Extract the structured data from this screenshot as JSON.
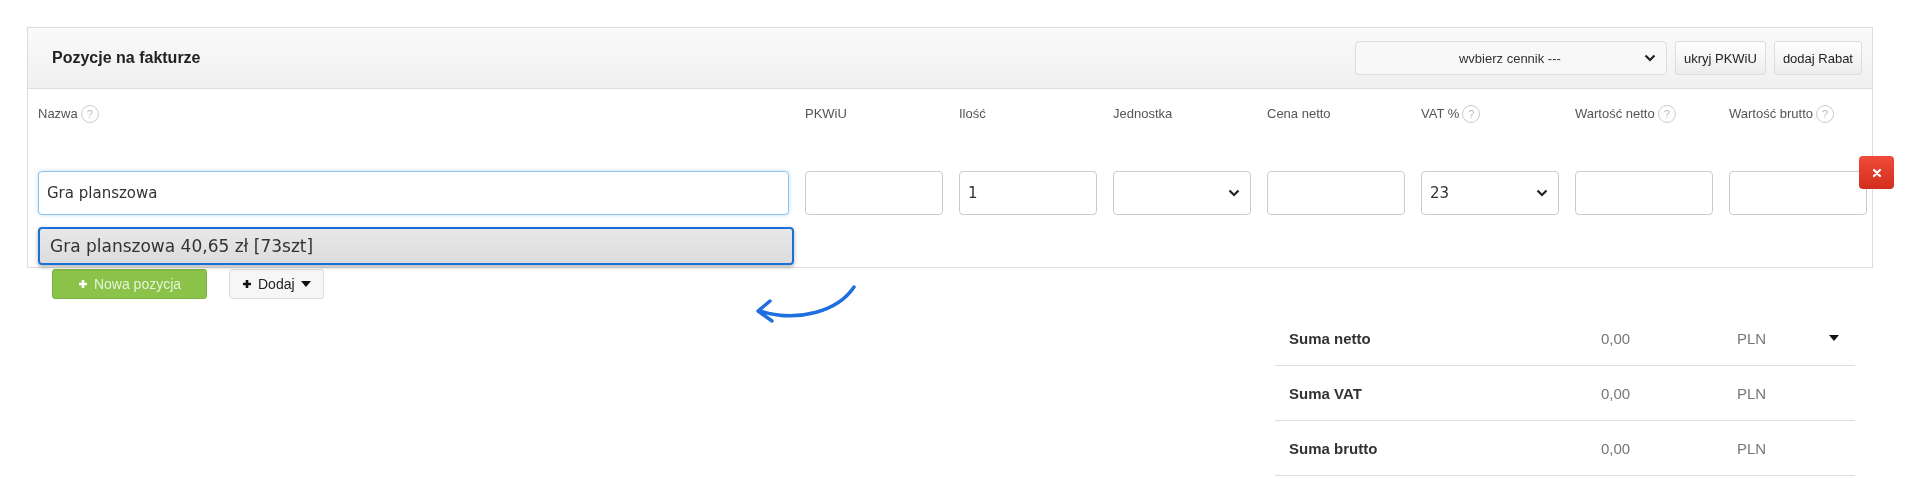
{
  "panel": {
    "title": "Pozycje na fakturze",
    "pricelist_select": {
      "value": "wvbierz cennik ---"
    },
    "header_buttons": [
      "ukryj PKWiU",
      "dodaj Rabat"
    ],
    "columns": [
      {
        "label": "Nazwa",
        "help": "?"
      },
      {
        "label": "PKWiU"
      },
      {
        "label": "Ilość"
      },
      {
        "label": "Jednostka"
      },
      {
        "label": "Cena netto"
      },
      {
        "label": "VAT %",
        "help": "?"
      },
      {
        "label": "Wartość netto",
        "help": "?"
      },
      {
        "label": "Wartość brutto",
        "help": "?"
      }
    ],
    "row": {
      "cells": [
        {
          "kind": "text",
          "value": "Gra planszowa",
          "focused": true
        },
        {
          "kind": "text",
          "focused": false
        },
        {
          "kind": "text",
          "value": "1",
          "focused": false
        },
        {
          "kind": "select",
          "focused": false
        },
        {
          "kind": "text",
          "focused": false
        },
        {
          "kind": "select",
          "value": "23",
          "focused": false
        },
        {
          "kind": "text",
          "focused": false
        },
        {
          "kind": "text",
          "focused": false
        }
      ]
    },
    "suggestions": [
      {
        "label": "Gra planszowa 40,65 zł [73szt]",
        "selected": true
      }
    ]
  },
  "add_buttons": [
    {
      "kind": "primary",
      "label": "Nowa pozycja"
    },
    {
      "kind": "dropdown",
      "label": "Dodaj"
    }
  ],
  "totals": [
    {
      "label": "Suma netto",
      "amount": "0,00",
      "currency": "PLN",
      "menu": true
    },
    {
      "label": "Suma VAT",
      "amount": "0,00",
      "currency": "PLN",
      "menu": false
    },
    {
      "label": "Suma brutto",
      "amount": "0,00",
      "currency": "PLN",
      "menu": false
    }
  ]
}
